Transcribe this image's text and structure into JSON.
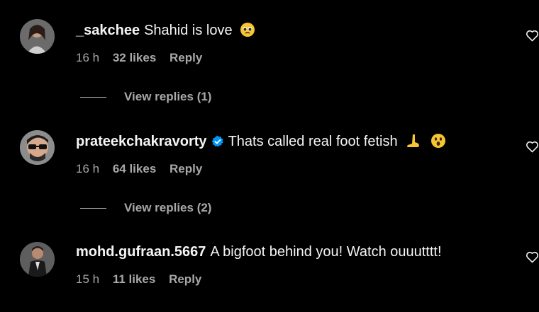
{
  "comments": [
    {
      "username": "_sakchee",
      "text": "Shahid is love",
      "time": "16 h",
      "likes": "32 likes",
      "reply": "Reply",
      "emoji": [
        "pleading-face-emoji"
      ]
    },
    {
      "username": "prateekchakravorty",
      "verified": true,
      "text": "Thats called real foot fetish",
      "time": "16 h",
      "likes": "64 likes",
      "reply": "Reply",
      "emoji": [
        "foot-emoji",
        "astonished-face-emoji"
      ]
    },
    {
      "username": "mohd.gufraan.5667",
      "text": "A bigfoot behind you! Watch ouuutttt!",
      "time": "15 h",
      "likes": "11 likes",
      "reply": "Reply"
    }
  ],
  "view_replies": [
    {
      "label": "View replies (1)"
    },
    {
      "label": "View replies (2)"
    }
  ],
  "colors": {
    "background": "#000000",
    "primary_text": "#f5f5f5",
    "secondary_text": "#a8a8a8",
    "verified": "#0095f6",
    "emoji_yellow": "#f7c531"
  }
}
